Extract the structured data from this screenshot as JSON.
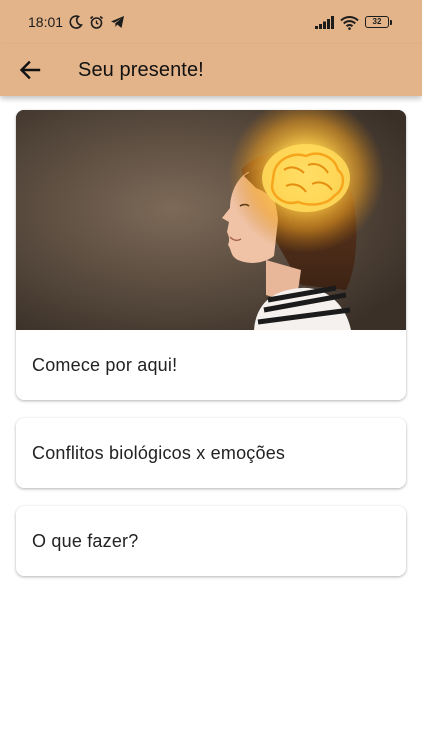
{
  "status_bar": {
    "time": "18:01",
    "battery": "32"
  },
  "app_bar": {
    "title": "Seu presente!"
  },
  "cards": [
    {
      "label": "Comece por aqui!",
      "has_image": true
    },
    {
      "label": "Conflitos biológicos x emoções",
      "has_image": false
    },
    {
      "label": "O que fazer?",
      "has_image": false
    }
  ],
  "colors": {
    "app_bar": "#e3b48a",
    "background": "#ffffff"
  },
  "icons": {
    "status_left": [
      "moon-icon",
      "alarm-clock-icon",
      "telegram-icon"
    ],
    "status_right": [
      "signal-icon",
      "wifi-icon",
      "battery-icon"
    ],
    "back": "arrow-left-icon"
  }
}
